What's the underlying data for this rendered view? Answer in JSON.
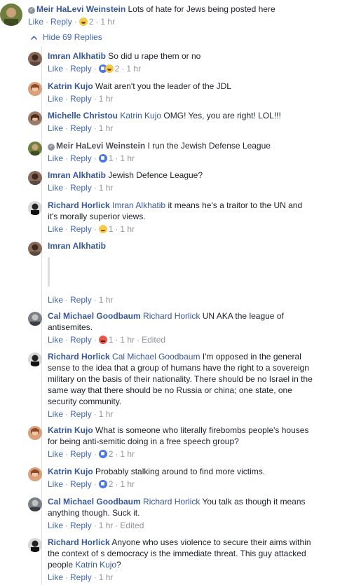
{
  "top_comment": {
    "author": "Meir HaLevi Weinstein",
    "text": "Lots of hate for Jews being posted here",
    "like": "Like",
    "reply": "Reply",
    "reaction_count": "2",
    "time": "1 hr"
  },
  "hide_replies_label": "Hide 69 Replies",
  "replies": [
    {
      "author": "Imran Alkhatib",
      "tag": "",
      "text": "So did u rape them or no",
      "like": "Like",
      "reply": "Reply",
      "reaction_count": "2",
      "time": "1 hr",
      "edited": ""
    },
    {
      "author": "Katrin Kujo",
      "tag": "",
      "text": "Wait aren't you the leader of the JDL",
      "like": "Like",
      "reply": "Reply",
      "reaction_count": "",
      "time": "1 hr",
      "edited": ""
    },
    {
      "author": "Michelle Christou",
      "tag": "Katrin Kujo",
      "text": "OMG! Yes, you are right! LOL!!!",
      "like": "Like",
      "reply": "Reply",
      "reaction_count": "",
      "time": "1 hr",
      "edited": ""
    },
    {
      "author": "Meir HaLevi Weinstein",
      "tag": "",
      "text": "I run the Jewish Defense League",
      "like": "Like",
      "reply": "Reply",
      "reaction_count": "1",
      "time": "1 hr",
      "edited": ""
    },
    {
      "author": "Imran Alkhatib",
      "tag": "",
      "text": "Jewish Defence League?",
      "like": "Like",
      "reply": "Reply",
      "reaction_count": "",
      "time": "1 hr",
      "edited": ""
    },
    {
      "author": "Richard Horlick",
      "tag": "Imran Alkhatib",
      "text": "it means he's a traitor to the UN and it's morally superior views.",
      "like": "Like",
      "reply": "Reply",
      "reaction_count": "1",
      "time": "1 hr",
      "edited": ""
    },
    {
      "author": "Imran Alkhatib",
      "tag": "",
      "text": "",
      "like": "Like",
      "reply": "Reply",
      "reaction_count": "",
      "time": "1 hr",
      "edited": ""
    },
    {
      "author": "Cal Michael Goodbaum",
      "tag": "Richard Horlick",
      "text": "UN AKA the league of antisemites.",
      "like": "Like",
      "reply": "Reply",
      "reaction_count": "1",
      "time": "1 hr",
      "edited": "Edited"
    },
    {
      "author": "Richard Horlick",
      "tag": "Cal Michael Goodbaum",
      "text": "I'm opposed in the general sense to the idea that a group of humans have the right to a sovereign military on the basis of their nationality. There should be no Israel in the same way that there should be no Russia or china; one state, one security community.",
      "like": "Like",
      "reply": "Reply",
      "reaction_count": "",
      "time": "1 hr",
      "edited": ""
    },
    {
      "author": "Katrin Kujo",
      "tag": "",
      "text": "What is someone who literally firebombs people's houses for being anti-semitic doing in a free speech group?",
      "like": "Like",
      "reply": "Reply",
      "reaction_count": "2",
      "time": "1 hr",
      "edited": ""
    },
    {
      "author": "Katrin Kujo",
      "tag": "",
      "text": "Probably stalking around to find more victims.",
      "like": "Like",
      "reply": "Reply",
      "reaction_count": "2",
      "time": "1 hr",
      "edited": ""
    },
    {
      "author": "Cal Michael Goodbaum",
      "tag": "Richard Horlick",
      "text": "You talk as though it means anything though. Suck it.",
      "like": "Like",
      "reply": "Reply",
      "reaction_count": "",
      "time": "1 hr",
      "edited": "Edited"
    },
    {
      "author": "Richard Horlick",
      "tag": "",
      "text": "Anyone who uses violence to secure their aims within the context of s democracy is the immediate threat. This guy attacked people",
      "tag_end": "Katrin Kujo",
      "text_end": "?",
      "like": "Like",
      "reply": "Reply",
      "reaction_count": "",
      "time": "1 hr",
      "edited": ""
    }
  ],
  "colors": {
    "link": "#4267b2",
    "name": "#385898",
    "meta": "#90949c",
    "line": "#dddfe2"
  }
}
